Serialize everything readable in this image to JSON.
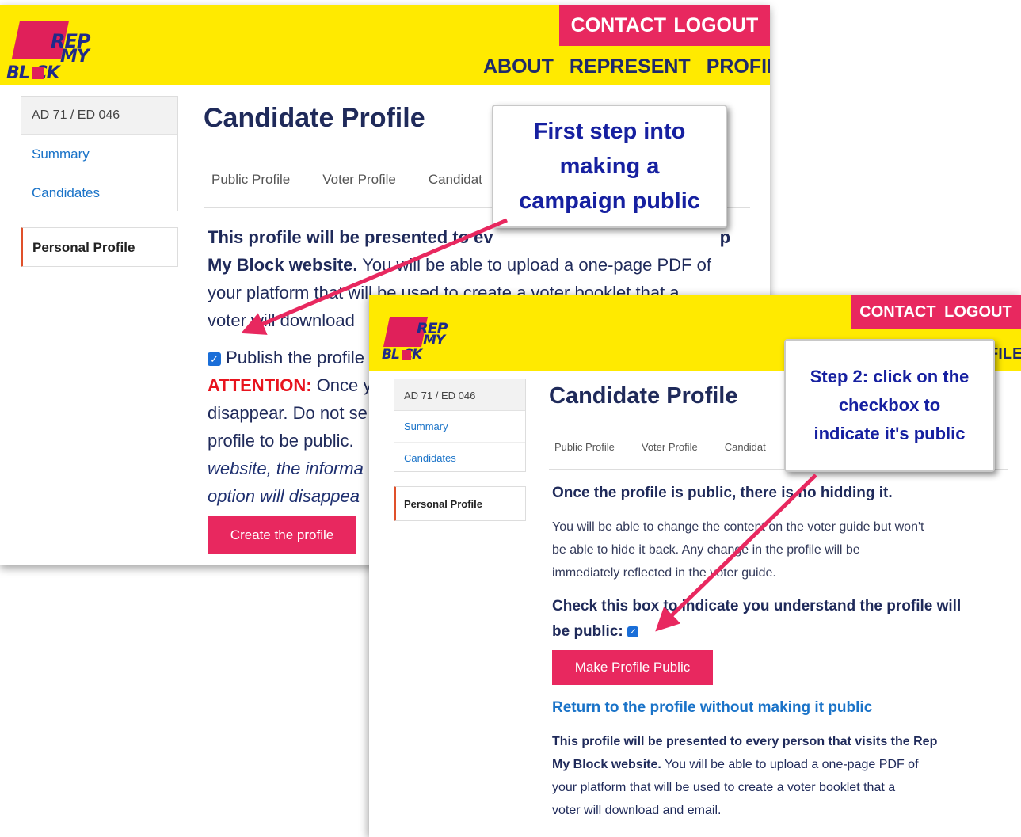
{
  "logo": {
    "line1": "REP",
    "line2": "MY",
    "line3": "BL  CK"
  },
  "nav": {
    "contact": "CONTACT",
    "logout": "LOGOUT",
    "about": "ABOUT",
    "represent": "REPRESENT",
    "profile": "PROFILE",
    "profile_partial": "FILE"
  },
  "sidebar": {
    "district": "AD 71 / ED 046",
    "summary": "Summary",
    "candidates": "Candidates",
    "personal_profile": "Personal Profile"
  },
  "page": {
    "title": "Candidate Profile",
    "tabs": [
      "Public Profile",
      "Voter Profile",
      "Candidat"
    ]
  },
  "step1": {
    "intro_bold": "This profile will be presented to ev",
    "intro_bold_end": "p",
    "intro_bold2": "My Block website.",
    "intro_rest_a": " You will be able to upload a one-page PDF of",
    "intro_line3": "your platform that will be used to create a voter booklet that a",
    "intro_line4": "voter will download",
    "publish_label": "Publish the profile",
    "attention_label": "ATTENTION:",
    "attention_text": " Once y",
    "line_disappear": "disappear. Do not se",
    "line_public": "profile to be public.",
    "line_website": "website, the informa",
    "line_option": "option will disappea",
    "create_button": "Create the profile",
    "callout": [
      "First step into",
      "making a",
      "campaign public"
    ]
  },
  "step2": {
    "heading": "Once the profile is public, there is no hidding it.",
    "body_lines": [
      "You will be able to change the content on the voter guide but won't",
      "be able to hide it back. Any change in the profile will be",
      "immediately reflected in the voter guide."
    ],
    "check_line1": "Check this box to indicate you understand the profile will",
    "check_line2": "be public:",
    "make_public_button": "Make Profile Public",
    "return_link": "Return to the profile without making it public",
    "footer_bold_1": "This profile will be presented to every person that visits the Rep",
    "footer_bold_2": "My Block website.",
    "footer_rest_2": " You will be able to upload a one-page PDF of",
    "footer_line3": "your platform that will be used to create a voter booklet that a",
    "footer_line4": "voter will download and email.",
    "callout": [
      "Step 2: click on the",
      "checkbox to",
      "indicate it's public"
    ]
  },
  "colors": {
    "brand_yellow": "#ffea00",
    "brand_pink": "#e8285f",
    "navy": "#1f2a5a",
    "link_blue": "#1a73c8",
    "arrow_red": "#e8285f",
    "callout_text": "#1620a0"
  },
  "icons": {
    "checkbox": "checked-checkbox-icon",
    "arrow": "red-arrow-icon"
  }
}
